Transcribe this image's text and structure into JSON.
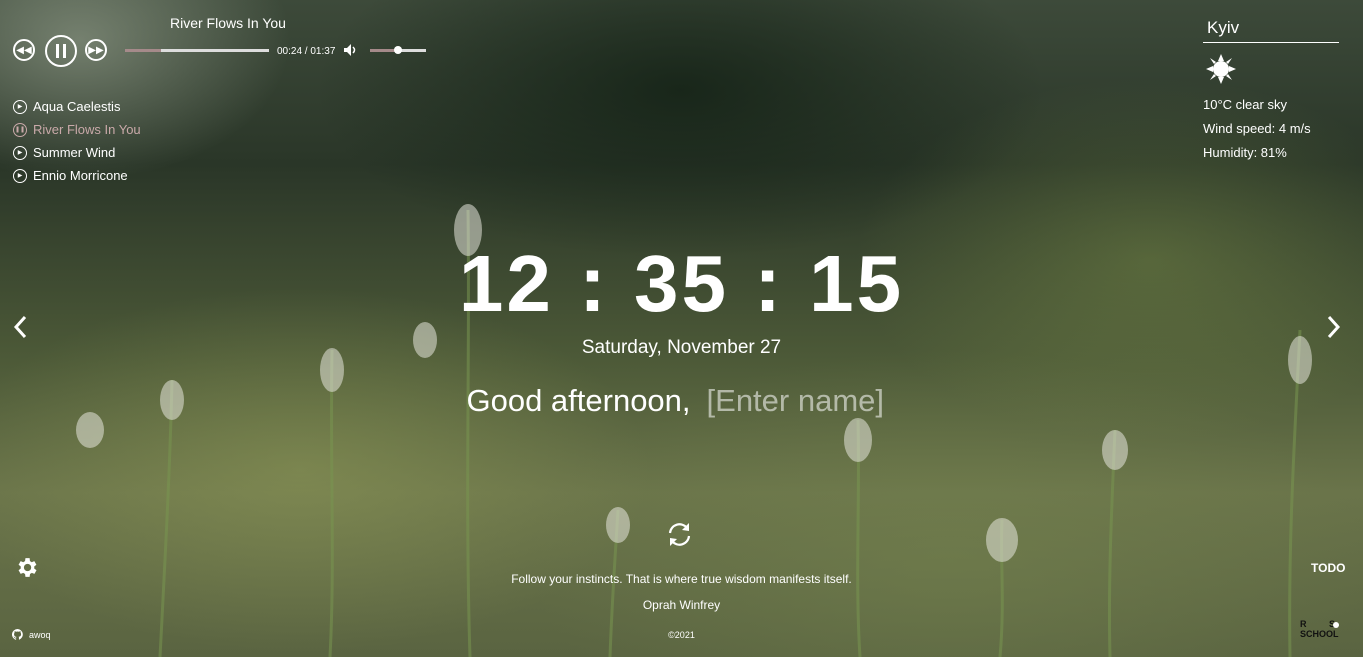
{
  "player": {
    "current_title": "River Flows In You",
    "time": "00:24 / 01:37",
    "progress": 0.25,
    "volume": 0.5,
    "playlist": [
      {
        "title": "Aqua Caelestis",
        "state": "play"
      },
      {
        "title": "River Flows In You",
        "state": "pause"
      },
      {
        "title": "Summer Wind",
        "state": "play"
      },
      {
        "title": "Ennio Morricone",
        "state": "play"
      }
    ]
  },
  "weather": {
    "city": "Kyiv",
    "icon": "sun-icon",
    "temp_desc": "10°C   clear sky",
    "wind": "Wind speed: 4 m/s",
    "humidity": "Humidity: 81%"
  },
  "clock": {
    "time": "12:35:15",
    "date": "Saturday, November 27"
  },
  "greeting": {
    "text": "Good afternoon,",
    "name_placeholder": "[Enter name]"
  },
  "quote": {
    "text": "Follow your instincts. That is where true wisdom manifests itself.",
    "author": "Oprah Winfrey"
  },
  "footer": {
    "github_user": "awoq",
    "copyright": "©2021",
    "todo_label": "TODO",
    "school_logo": "RS SCHOOL"
  },
  "colors": {
    "active_track": "#c9a9a9",
    "progress_fill": "#a58a8a"
  }
}
